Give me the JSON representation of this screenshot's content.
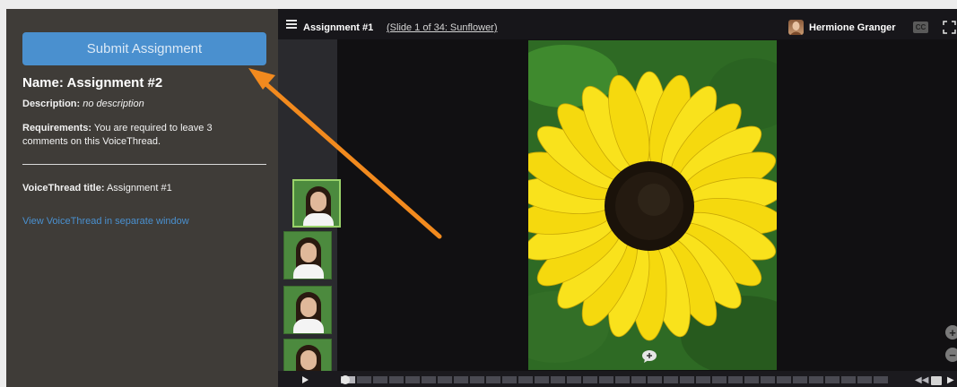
{
  "assignment": {
    "submit_label": "Submit Assignment",
    "name_label": "Name:",
    "name_value": "Assignment #2",
    "description_label": "Description:",
    "description_value": "no description",
    "requirements_label": "Requirements:",
    "requirements_value": "You are required to leave 3 comments on this VoiceThread.",
    "vt_title_label": "VoiceThread title:",
    "vt_title_value": "Assignment #1",
    "view_link": "View VoiceThread in separate window"
  },
  "player": {
    "title": "Assignment #1",
    "slide_info": "(Slide 1 of 34: Sunflower)",
    "user_name": "Hermione Granger",
    "cc_label": "CC",
    "zoom_in": "+",
    "zoom_out": "−",
    "slides_total": 34,
    "current_slide": 1
  },
  "colors": {
    "accent": "#4a90cf",
    "panel_bg": "#3f3c38",
    "player_bg": "#111012",
    "arrow": "#f28a1e",
    "thumb_active_border": "#9ad26a"
  },
  "icons": {
    "menu": "menu-icon",
    "fullscreen": "fullscreen-icon",
    "play": "play-icon",
    "comment": "comment-icon",
    "rewind": "rewind-icon",
    "fast_forward": "fast-forward-icon"
  }
}
